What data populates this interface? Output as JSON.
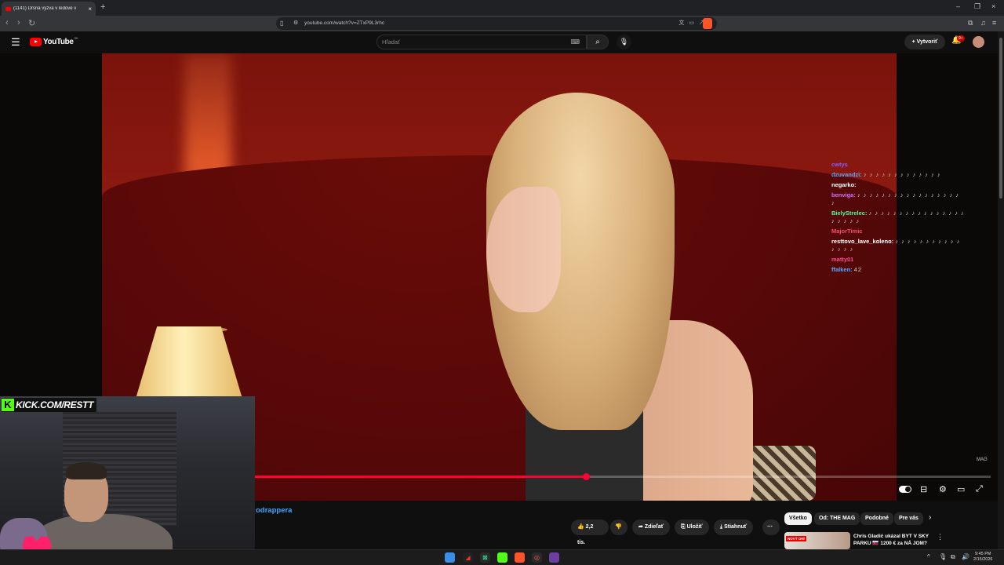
{
  "browser": {
    "tab_title": "(1141) Drsná výzva v ledové v",
    "tab_close": "×",
    "new_tab": "+",
    "url": "youtube.com/watch?v=ZTxP9L3rhc",
    "window_controls": [
      "–",
      "❐",
      "×"
    ]
  },
  "youtube": {
    "logo_text": "YouTube",
    "country_code": "SK",
    "search_placeholder": "Hľadať",
    "create_label": "Vytvoriť",
    "notification_badge": "9+"
  },
  "player": {
    "watermark": "MAG",
    "progress_fraction": 0.45
  },
  "chat": [
    {
      "user": "cwtys",
      "color": "#8b5cf6",
      "text": ""
    },
    {
      "user": "dzuvandzi:",
      "color": "#5aa8ff",
      "text": "♪ ♪ ♪ ♪ ♪ ♪ ♪ ♪ ♪ ♪ ♪ ♪ ♪"
    },
    {
      "user": "negarko:",
      "color": "#ffffff",
      "text": ""
    },
    {
      "user": "benviga:",
      "color": "#d36cff",
      "text": "♪ ♪ ♪ ♪ ♪ ♪ ♪ ♪ ♪ ♪ ♪ ♪ ♪ ♪ ♪ ♪ ♪ ♪"
    },
    {
      "user": "BielyStrelec:",
      "color": "#53fc9a",
      "text": "♪ ♪ ♪ ♪ ♪ ♪ ♪ ♪ ♪ ♪ ♪ ♪ ♪ ♪ ♪ ♪ ♪ ♪ ♪ ♪ ♪"
    },
    {
      "user": "MajorTimic",
      "color": "#ff4d6d",
      "text": ""
    },
    {
      "user": "resttovo_lave_koleno:",
      "color": "#ffffff",
      "text": "♪ ♪ ♪ ♪ ♪ ♪ ♪ ♪ ♪ ♪ ♪ ♪ ♪ ♪ ♪"
    },
    {
      "user": "matty01",
      "color": "#ff4d8d",
      "text": ""
    },
    {
      "user": "ffalken:",
      "color": "#5aa8ff",
      "text": "42"
    }
  ],
  "webcam": {
    "banner_k": "K",
    "banner_text": "KICK.COM/RESTT"
  },
  "below": {
    "channel_text": "odrappera",
    "like_count": "2,2 tis.",
    "share_label": "Zdieľať",
    "save_label": "Uložiť",
    "download_label": "Stiahnuť",
    "more": "⋯"
  },
  "chips": [
    "Všetko",
    "Od: THE MAG",
    "Podobné",
    "Pre vás"
  ],
  "recommendation": {
    "badge": "NOVÝ DNÍ",
    "title": "Chris Gladić ukázal BYT V SKY PARKU 🇸🇰 1200 € za NÁ JOM?"
  },
  "taskbar": {
    "time": "9:45 PM",
    "date": "2/15/2026"
  },
  "colors": {
    "youtube_red": "#ff0000",
    "progress_red": "#ff0033",
    "kick_green": "#53fc18",
    "link_blue": "#3ea6ff"
  }
}
